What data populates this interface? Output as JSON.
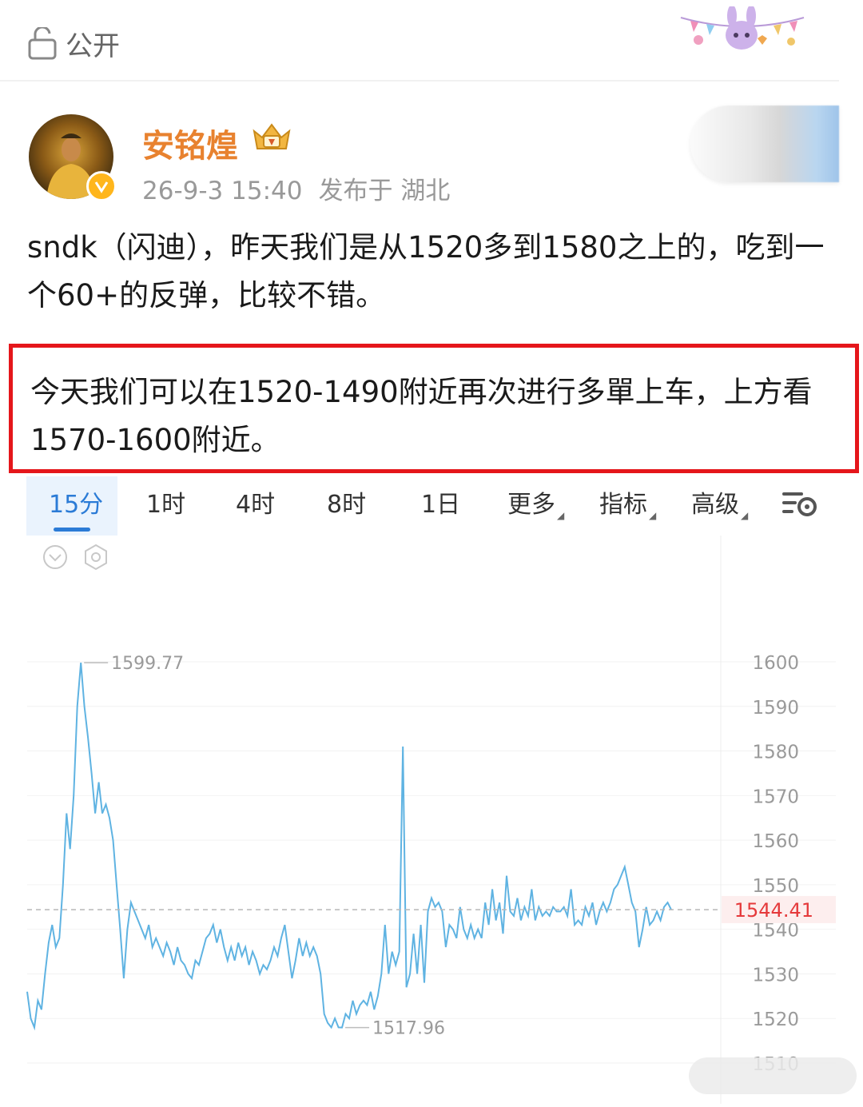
{
  "header": {
    "visibility_label": "公开"
  },
  "post": {
    "username": "安铭煌",
    "timestamp": "26-9-3 15:40",
    "location": "发布于 湖北",
    "text": "sndk（闪迪），昨天我们是从1520多到1580之上的，吃到一个60+的反弹，比较不错。",
    "highlight_text": "今天我们可以在1520-1490附近再次进行多單上车，上方看1570-1600附近。"
  },
  "chart_tabs": [
    {
      "label": "15分",
      "active": true
    },
    {
      "label": "1时"
    },
    {
      "label": "4时"
    },
    {
      "label": "8时"
    },
    {
      "label": "1日"
    },
    {
      "label": "更多"
    },
    {
      "label": "指标"
    },
    {
      "label": "高级"
    }
  ],
  "chart_data": {
    "type": "line",
    "y_ticks": [
      "1600",
      "1590",
      "1580",
      "1570",
      "1560",
      "1550",
      "1540",
      "1530",
      "1520",
      "1510"
    ],
    "ylim": [
      1508,
      1628
    ],
    "grid": true,
    "max_label": "1599.77",
    "min_label": "1517.96",
    "current_price_label": "1544.41",
    "current_price": 1544.41,
    "series": [
      {
        "color": "#5fb3e2",
        "values": [
          1526,
          1520,
          1518,
          1524,
          1522,
          1530,
          1537,
          1541,
          1536,
          1538,
          1550,
          1566,
          1558,
          1570,
          1590,
          1599.8,
          1590,
          1583,
          1575,
          1566,
          1573,
          1566,
          1568,
          1565,
          1560,
          1550,
          1540,
          1529,
          1540,
          1546,
          1544,
          1542,
          1540,
          1538,
          1541,
          1536,
          1538,
          1536,
          1534,
          1537,
          1535,
          1532,
          1536,
          1533,
          1532,
          1530,
          1529,
          1533,
          1532,
          1535,
          1538,
          1539,
          1541,
          1537,
          1540,
          1536,
          1533,
          1536,
          1533,
          1537,
          1534,
          1536,
          1532,
          1535,
          1533,
          1530,
          1532,
          1531,
          1533,
          1536,
          1534,
          1538,
          1541,
          1535,
          1529,
          1533,
          1538,
          1534,
          1537,
          1534,
          1536,
          1534,
          1530,
          1521,
          1519,
          1518,
          1520,
          1518,
          1517.96,
          1521,
          1520,
          1524,
          1521,
          1523,
          1524,
          1523,
          1526,
          1522,
          1525,
          1530,
          1541,
          1530,
          1535,
          1532,
          1535,
          1581,
          1527,
          1530,
          1539,
          1530,
          1541,
          1528,
          1544,
          1547,
          1545,
          1546,
          1544,
          1536,
          1541,
          1540,
          1538,
          1545,
          1540,
          1538,
          1541,
          1538,
          1540,
          1538,
          1546,
          1541,
          1549,
          1542,
          1546,
          1539,
          1552,
          1544,
          1543,
          1547,
          1542,
          1545,
          1543,
          1549,
          1542,
          1545,
          1543,
          1544,
          1543,
          1545,
          1544,
          1544,
          1545,
          1543,
          1549,
          1541,
          1542,
          1541,
          1545,
          1543,
          1546,
          1541,
          1544,
          1546,
          1544,
          1546,
          1549,
          1550,
          1552,
          1554,
          1550,
          1546,
          1544,
          1536,
          1540,
          1545,
          1541,
          1542,
          1544,
          1542,
          1545,
          1546,
          1544.41
        ]
      }
    ]
  },
  "colors": {
    "accent_blue": "#2b7bd6",
    "highlight_red": "#e5161b",
    "username_orange": "#e8822f",
    "price_red": "#e5393b"
  }
}
